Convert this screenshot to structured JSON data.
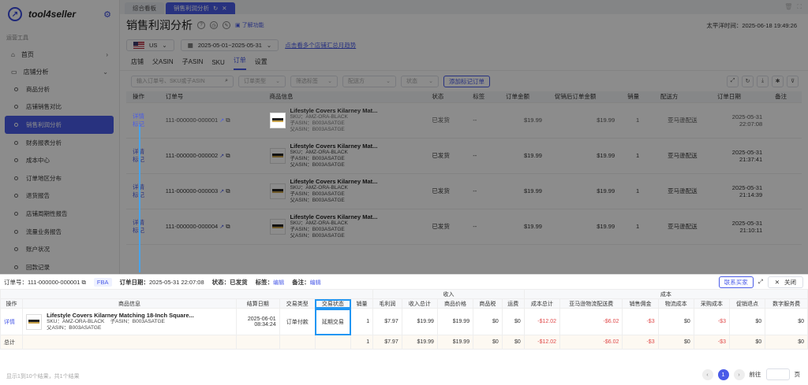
{
  "app": {
    "name": "tool4seller"
  },
  "sidebar": {
    "section": "运营工具",
    "home": "首页",
    "shop": "店铺分析",
    "items": [
      "商品分析",
      "店铺销售对比",
      "销售利润分析",
      "财务报表分析",
      "成本中心",
      "订单地区分布",
      "退货报告",
      "店铺周期性报告",
      "流量业务报告",
      "账户状况",
      "回款记录"
    ]
  },
  "tabs": [
    "综合看板",
    "销售利润分析"
  ],
  "header": {
    "title": "销售利润分析",
    "learn": "了解功能",
    "timezone": "太平洋时间：2025-06-18 19:49:26"
  },
  "filters": {
    "marketplace": "US",
    "daterange": "2025-05-01~2025-05-31",
    "link": "点击看多个店铺汇总月趋势"
  },
  "subtabs": [
    "店铺",
    "父ASIN",
    "子ASIN",
    "SKU",
    "订单",
    "设置"
  ],
  "search": {
    "placeholder": "输入订单号、SKU或子ASIN",
    "type": "订单类型",
    "tag": "筛选标签",
    "ship": "配送方",
    "status": "状态",
    "add": "添加标记订单"
  },
  "table": {
    "headers": [
      "操作",
      "订单号",
      "商品信息",
      "状态",
      "标签",
      "订单金额",
      "促销后订单金额",
      "销量",
      "配送方",
      "订单日期",
      "备注"
    ],
    "rows": [
      {
        "a1": "详情",
        "a2": "标记",
        "id": "111-000000-000001",
        "name": "Lifestyle Covers Kilarney Mat...",
        "sku": "SKU：AMZ-ORA-BLACK",
        "asin": "子ASIN：B003ASATGE",
        "pasin": "父ASIN：B003ASATGE",
        "status": "已发货",
        "tag": "--",
        "amt": "$19.99",
        "promo": "$19.99",
        "qty": "1",
        "ship": "亚马逊配送",
        "d1": "2025-05-31",
        "d2": "22:07:08"
      },
      {
        "a1": "详情",
        "a2": "标记",
        "id": "111-000000-000002",
        "name": "Lifestyle Covers Kilarney Mat...",
        "sku": "SKU：AMZ-ORA-BLACK",
        "asin": "子ASIN：B003ASATGE",
        "pasin": "父ASIN：B003ASATGE",
        "status": "已发货",
        "tag": "--",
        "amt": "$19.99",
        "promo": "$19.99",
        "qty": "1",
        "ship": "亚马逊配送",
        "d1": "2025-05-31",
        "d2": "21:37:41"
      },
      {
        "a1": "详情",
        "a2": "标记",
        "id": "111-000000-000003",
        "name": "Lifestyle Covers Kilarney Mat...",
        "sku": "SKU：AMZ-ORA-BLACK",
        "asin": "子ASIN：B003ASATGE",
        "pasin": "父ASIN：B003ASATGE",
        "status": "已发货",
        "tag": "--",
        "amt": "$19.99",
        "promo": "$19.99",
        "qty": "1",
        "ship": "亚马逊配送",
        "d1": "2025-05-31",
        "d2": "21:14:39"
      },
      {
        "a1": "详情",
        "a2": "标记",
        "id": "111-000000-000004",
        "name": "Lifestyle Covers Kilarney Mat...",
        "sku": "SKU：AMZ-ORA-BLACK",
        "asin": "子ASIN：B003ASATGE",
        "pasin": "父ASIN：B003ASATGE",
        "status": "已发货",
        "tag": "--",
        "amt": "$19.99",
        "promo": "$19.99",
        "qty": "1",
        "ship": "亚马逊配送",
        "d1": "2025-05-31",
        "d2": "21:10:11"
      }
    ]
  },
  "panel": {
    "order": "订单号：111-000000-000001",
    "fba": "FBA",
    "date_label": "订单日期：",
    "date": "2025-05-31 22:07:08",
    "status": "状态：已发货",
    "tag_label": "标签：",
    "edit": "编辑",
    "note_label": "备注：",
    "contact": "联系买家",
    "close": "关闭",
    "group_income": "收入",
    "group_cost": "成本",
    "headers": [
      "操作",
      "商品信息",
      "结算日期",
      "交易类型",
      "交易状态",
      "销量",
      "毛利润",
      "收入总计",
      "商品价格",
      "商品税",
      "运费",
      "成本总计",
      "亚马逊物流配送费",
      "销售佣金",
      "物流成本",
      "采购成本",
      "促销退点",
      "数字服务费"
    ],
    "row": {
      "act": "详情",
      "name": "Lifestyle Covers Kilarney Matching 18-Inch Square...",
      "sku": "SKU：AMZ-ORA-BLACK",
      "asin": "子ASIN：B003ASATGE",
      "pasin": "父ASIN：B003ASATGE",
      "d1": "2025-06-01",
      "d2": "08:34:24",
      "type": "订单付款",
      "tstatus": "延期交易",
      "qty": "1",
      "gp": "$7.97",
      "inc": "$19.99",
      "price": "$19.99",
      "tax": "$0",
      "ship": "$0",
      "cost": "-$12.02",
      "fba": "-$6.02",
      "comm": "-$3",
      "log": "$0",
      "pur": "-$3",
      "promo": "$0",
      "dig": "$0"
    },
    "total": {
      "label": "总计",
      "qty": "1",
      "gp": "$7.97",
      "inc": "$19.99",
      "price": "$19.99",
      "tax": "$0",
      "ship": "$0",
      "cost": "-$12.02",
      "fba": "-$6.02",
      "comm": "-$3",
      "log": "$0",
      "pur": "-$3",
      "promo": "$0",
      "dig": "$0"
    },
    "footer": "显示1到10个结果，共1个结果",
    "page": "1",
    "goto": "前往",
    "page_unit": "页"
  }
}
